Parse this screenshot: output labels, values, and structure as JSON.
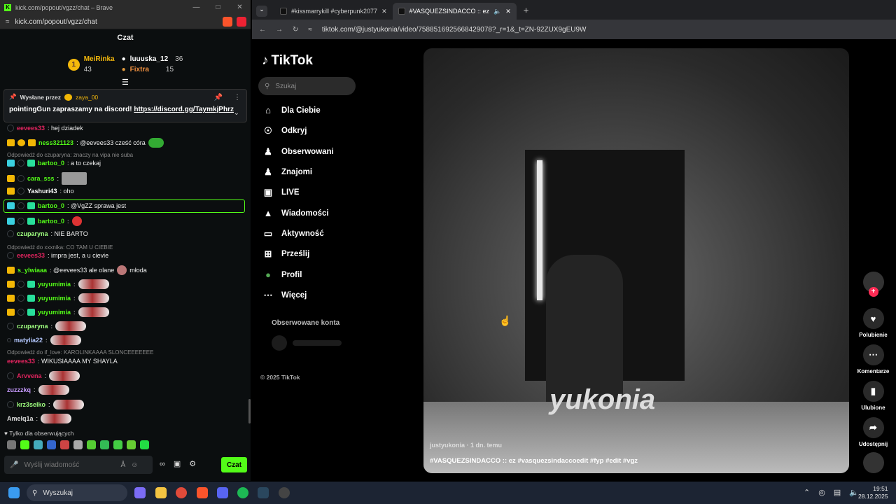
{
  "kick_window": {
    "title": "kick.com/popout/vgzz/chat – Brave",
    "url": "kick.com/popout/vgzz/chat",
    "chat_header": "Czat",
    "leaderboard": {
      "first": {
        "rank": "1",
        "name": "MeiRinka",
        "count": "43"
      },
      "second": {
        "name": "luuuska_12",
        "count": "36"
      },
      "third": {
        "name": "Fixtra",
        "count": "15"
      }
    },
    "pinned": {
      "label": "Wysłane przez",
      "by": "zaya_00",
      "text": "pointingGun zapraszamy na discord!",
      "link": "https://discord.gg/TaymkjPhrz"
    },
    "messages": [
      {
        "user": "eevees33",
        "text": ": hej dziadek",
        "color": "#e0245e"
      },
      {
        "user": "ness321123",
        "text": ": @eevees33 cześć córa",
        "color": "#53fc18"
      },
      {
        "reply": "Odpowiedź do czuparyna: znaczy na vipa nie suba"
      },
      {
        "user": "bartoo_0",
        "text": ": a to czekaj",
        "color": "#53fc18"
      },
      {
        "user": "cara_sss",
        "text": ":",
        "color": "#53fc18"
      },
      {
        "user": "Yashuri43",
        "text": ": oho",
        "color": "#ffffff"
      },
      {
        "user": "bartoo_0",
        "text": ": @VgZZ sprawa jest",
        "color": "#53fc18"
      },
      {
        "user": "bartoo_0",
        "text": ":",
        "color": "#53fc18"
      },
      {
        "user": "czuparyna",
        "text": ": NIE BARTO",
        "color": "#a0ff80"
      },
      {
        "reply": "Odpowiedź do xxxnika: CO TAM U CIEBIE"
      },
      {
        "user": "eevees33",
        "text": ": impra jest, a u cievie",
        "color": "#e0245e"
      },
      {
        "user": "s_ylwiaaa",
        "text": ": @eevees33 ale olane",
        "extra": "młoda",
        "color": "#53fc18"
      },
      {
        "user": "yuyumimia",
        "text": ":",
        "color": "#53fc18"
      },
      {
        "user": "yuyumimia",
        "text": ":",
        "color": "#53fc18"
      },
      {
        "user": "yuyumimia",
        "text": ":",
        "color": "#53fc18"
      },
      {
        "user": "czuparyna",
        "text": ":",
        "color": "#a0ff80"
      },
      {
        "user": "matylia22",
        "text": ":",
        "color": "#b4c8ff"
      },
      {
        "reply": "Odpowiedź do if_love: KAROLINKAAAA SLONCEEEEEEE"
      },
      {
        "user": "eevees33",
        "text": ": WIKUSIAAAA MY SHAYLA",
        "color": "#e0245e"
      },
      {
        "user": "Arvvena",
        "text": ":",
        "color": "#e0245e"
      },
      {
        "user": "zuzzzkq",
        "text": ":",
        "color": "#c89bff"
      },
      {
        "user": "krz3selko",
        "text": ":",
        "color": "#a0ff80"
      },
      {
        "user": "Amelq1a",
        "text": ":",
        "color": "#dddddd"
      }
    ],
    "follow_only": "Tylko dla obserwujących",
    "input_placeholder": "Wyślij wiadomość",
    "send_label": "Czat"
  },
  "browser": {
    "tabs": [
      {
        "label": "#kissmarrykill #cyberpunk2077"
      },
      {
        "label": "#VASQUEZSINDACCO :: ez"
      }
    ],
    "url": "tiktok.com/@justyukonia/video/7588516925668429078?_r=1&_t=ZN-92ZUX9gEU9W"
  },
  "tiktok": {
    "logo": "TikTok",
    "search_placeholder": "Szukaj",
    "nav": [
      {
        "label": "Dla Ciebie",
        "icon": "home-icon"
      },
      {
        "label": "Odkryj",
        "icon": "compass-icon"
      },
      {
        "label": "Obserwowani",
        "icon": "following-icon"
      },
      {
        "label": "Znajomi",
        "icon": "friends-icon"
      },
      {
        "label": "LIVE",
        "icon": "live-icon"
      },
      {
        "label": "Wiadomości",
        "icon": "messages-icon"
      },
      {
        "label": "Aktywność",
        "icon": "activity-icon"
      },
      {
        "label": "Prześlij",
        "icon": "upload-icon"
      },
      {
        "label": "Profil",
        "icon": "profile-icon"
      },
      {
        "label": "Więcej",
        "icon": "more-icon"
      }
    ],
    "followed_heading": "Obserwowane konta",
    "copyright": "© 2025 TikTok",
    "video": {
      "watermark": "yukonia",
      "author": "justyukonia · 1 dn. temu",
      "description": "#VASQUEZSINDACCO :: ez #vasquezsindaccoedit #fyp #edit #vgz"
    },
    "actions": [
      {
        "label": "Polubienie"
      },
      {
        "label": "Komentarze"
      },
      {
        "label": "Ulubione"
      },
      {
        "label": "Udostępnij"
      }
    ]
  },
  "taskbar": {
    "search_label": "Wyszukaj",
    "time": "19:51",
    "date": "28.12.2025"
  },
  "colors": {
    "kick_green": "#53fc18",
    "tiktok_pink": "#fe2c55"
  }
}
